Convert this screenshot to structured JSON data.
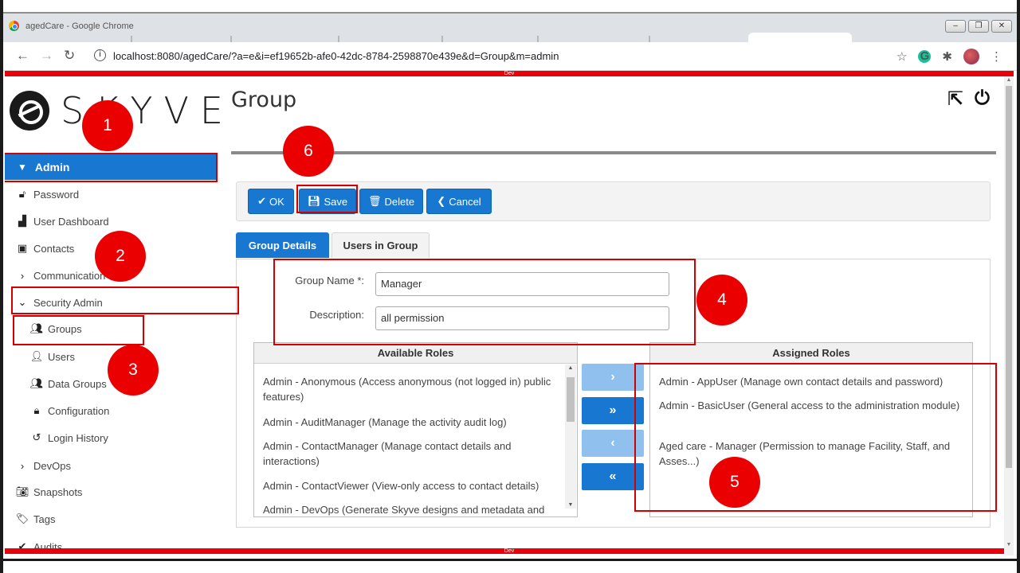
{
  "browser": {
    "window_title": "agedCare - Google Chrome",
    "url": "localhost:8080/agedCare/?a=e&i=ef19652b-afe0-42dc-8784-2598870e439e&d=Group&m=admin",
    "env_label": "Dev",
    "window_buttons": [
      "–",
      "❐",
      "✕"
    ]
  },
  "app": {
    "logo_text": "SKYVE",
    "page_title": "Group"
  },
  "sidebar": {
    "admin": "Admin",
    "items": [
      {
        "label": "Password",
        "icon": "lock-icon"
      },
      {
        "label": "User Dashboard",
        "icon": "chart-icon"
      },
      {
        "label": "Contacts",
        "icon": "contact-card-icon"
      },
      {
        "label": "Communication",
        "icon": "chevron-right-icon"
      },
      {
        "label": "Security Admin",
        "icon": "chevron-down-icon"
      },
      {
        "label": "Groups",
        "icon": "group-icon"
      },
      {
        "label": "Users",
        "icon": "user-icon"
      },
      {
        "label": "Data Groups",
        "icon": "group-icon"
      },
      {
        "label": "Configuration",
        "icon": "lock-icon"
      },
      {
        "label": "Login History",
        "icon": "history-icon"
      },
      {
        "label": "DevOps",
        "icon": "chevron-right-icon"
      },
      {
        "label": "Snapshots",
        "icon": "camera-icon"
      },
      {
        "label": "Tags",
        "icon": "tag-icon"
      },
      {
        "label": "Audits",
        "icon": "check-icon"
      }
    ]
  },
  "toolbar": {
    "ok": "OK",
    "save": "Save",
    "delete": "Delete",
    "cancel": "Cancel"
  },
  "tabs": {
    "details": "Group Details",
    "users": "Users in Group"
  },
  "form": {
    "name_label": "Group Name *:",
    "name_value": "Manager",
    "desc_label": "Description:",
    "desc_value": "all permission"
  },
  "roles": {
    "available_header": "Available Roles",
    "assigned_header": "Assigned Roles",
    "available": [
      "Admin - Anonymous (Access anonymous (not logged in) public features)",
      "Admin - AuditManager (Manage the activity audit log)",
      "Admin - ContactManager (Manage contact details and interactions)",
      "Admin - ContactViewer (View-only access to contact details)",
      "Admin - DevOps (Generate Skyve designs and metadata and"
    ],
    "assigned": [
      "Admin - AppUser (Manage own contact details and password)",
      "Admin - BasicUser (General access to the administration module)",
      "Aged care - Manager (Permission to manage Facility, Staff, and Asses...)"
    ],
    "move_buttons": [
      "›",
      "»",
      "‹",
      "«"
    ]
  },
  "callouts": [
    "1",
    "2",
    "3",
    "4",
    "5",
    "6"
  ],
  "colors": {
    "accent": "#1777d1",
    "dev_bar": "#e8000b",
    "annotation_red": "#ea0000"
  }
}
